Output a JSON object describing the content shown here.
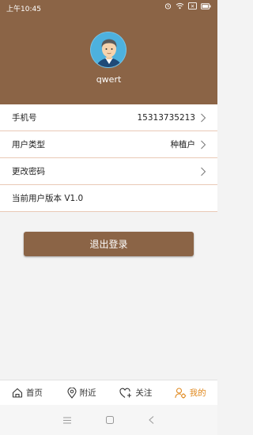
{
  "status_bar": {
    "time": "上午10:45",
    "battery_label": "✕",
    "icons": [
      "alarm-icon",
      "wifi-icon",
      "sim-icon",
      "battery-icon"
    ]
  },
  "profile": {
    "username": "qwert"
  },
  "menu": {
    "items": [
      {
        "label": "手机号",
        "value": "15313735213"
      },
      {
        "label": "用户类型",
        "value": "种植户"
      },
      {
        "label": "更改密码",
        "value": ""
      },
      {
        "label": "当前用户版本 V1.0",
        "value": ""
      }
    ]
  },
  "logout_label": "退出登录",
  "tabs": [
    {
      "label": "首页",
      "icon": "home-icon"
    },
    {
      "label": "附近",
      "icon": "location-pin-icon"
    },
    {
      "label": "关注",
      "icon": "heart-plus-icon"
    },
    {
      "label": "我的",
      "icon": "user-gear-icon",
      "active": true
    }
  ],
  "colors": {
    "brand_brown": "#8b6446",
    "active_orange": "#e0891f",
    "divider": "#e9c9b6"
  }
}
